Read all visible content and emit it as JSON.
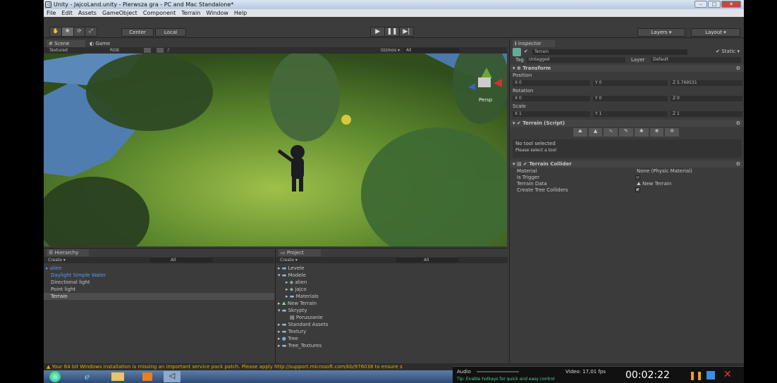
{
  "window": {
    "title": "Unity - JajcoLand.unity - Pierwsza gra - PC and Mac Standalone*"
  },
  "menu": [
    "File",
    "Edit",
    "Assets",
    "GameObject",
    "Component",
    "Terrain",
    "Window",
    "Help"
  ],
  "toolbar": {
    "pivot": "Center",
    "space": "Local",
    "layers": "Layers",
    "layout": "Layout"
  },
  "scene_tabs": {
    "scene": "Scene",
    "game": "Game"
  },
  "scene_bar": {
    "mode": "Textured",
    "color": "RGB",
    "gizmos": "Gizmos",
    "search": "All"
  },
  "scene_gizmo": {
    "label": "Persp"
  },
  "hierarchy": {
    "tab": "Hierarchy",
    "create": "Create",
    "search": "All",
    "items": [
      "alien",
      "Daylight Simple Water",
      "Directional light",
      "Point light",
      "Terrain"
    ]
  },
  "project": {
    "tab": "Project",
    "create": "Create",
    "search": "All",
    "items": [
      "Levele",
      "Modele",
      "alien",
      "jajco",
      "Materials",
      "New Terrain",
      "Skrypty",
      "Poruszanie",
      "Standard Assets",
      "Textury",
      "Tree",
      "Tree_Textures"
    ]
  },
  "inspector": {
    "tab": "Inspector",
    "object": "Terrain",
    "static": "Static",
    "tag_label": "Tag",
    "tag": "Untagged",
    "layer_label": "Layer",
    "layer": "Default",
    "transform": {
      "title": "Transform",
      "position": "Position",
      "rotation": "Rotation",
      "scale": "Scale",
      "px": "0",
      "py": "0",
      "pz": "5.769531",
      "rx": "0",
      "ry": "0",
      "rz": "0",
      "sx": "1",
      "sy": "1",
      "sz": "1"
    },
    "script": {
      "title": "Terrain (Script)",
      "status": "No tool selected",
      "hint": "Please select a tool"
    },
    "collider": {
      "title": "Terrain Collider",
      "material_label": "Material",
      "material": "None (Physic Material)",
      "trigger_label": "Is Trigger",
      "data_label": "Terrain Data",
      "data": "New Terrain",
      "trees_label": "Create Tree Colliders"
    }
  },
  "status": {
    "message": "Your 64 bit Windows installation is missing an important service pack patch. Please apply http://support.microsoft.com/kb/976038 to ensure s"
  },
  "recorder": {
    "audio": "Audio",
    "video": "Video: 17,01 fps",
    "tip": "Tip: Enable hotkeys for quick and easy control",
    "time": "00:02:22"
  }
}
